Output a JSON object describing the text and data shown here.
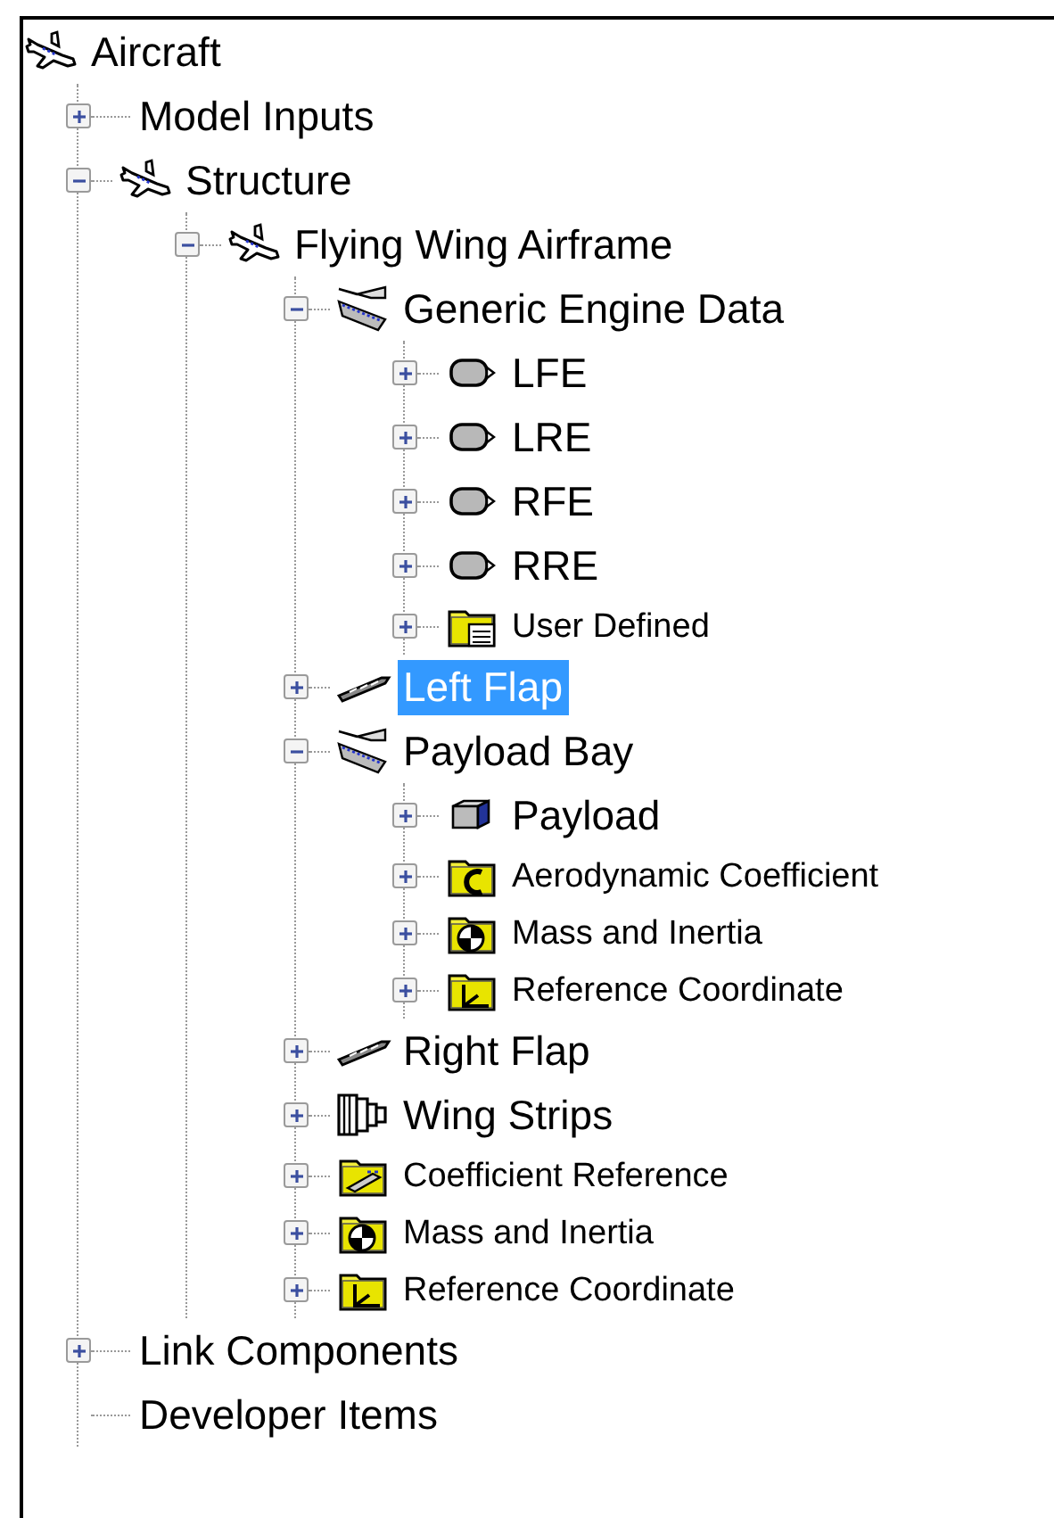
{
  "tree": {
    "label": "Aircraft",
    "kind": "aircraft",
    "selected": false,
    "children": [
      {
        "label": "Model Inputs",
        "kind": "none",
        "expandable": true,
        "expanded": false,
        "selected": false
      },
      {
        "label": "Structure",
        "kind": "aircraft",
        "expandable": true,
        "expanded": true,
        "selected": false,
        "children": [
          {
            "label": "Flying Wing Airframe",
            "kind": "aircraft",
            "expandable": true,
            "expanded": true,
            "selected": false,
            "children": [
              {
                "label": "Generic Engine Data",
                "kind": "section",
                "expandable": true,
                "expanded": true,
                "selected": false,
                "children": [
                  {
                    "label": "LFE",
                    "kind": "engine",
                    "expandable": true,
                    "expanded": false,
                    "selected": false
                  },
                  {
                    "label": "LRE",
                    "kind": "engine",
                    "expandable": true,
                    "expanded": false,
                    "selected": false
                  },
                  {
                    "label": "RFE",
                    "kind": "engine",
                    "expandable": true,
                    "expanded": false,
                    "selected": false
                  },
                  {
                    "label": "RRE",
                    "kind": "engine",
                    "expandable": true,
                    "expanded": false,
                    "selected": false
                  },
                  {
                    "label": "User Defined",
                    "kind": "document-folder",
                    "expandable": true,
                    "expanded": false,
                    "selected": false
                  }
                ]
              },
              {
                "label": "Left Flap",
                "kind": "flap",
                "expandable": true,
                "expanded": false,
                "selected": true
              },
              {
                "label": "Payload Bay",
                "kind": "section",
                "expandable": true,
                "expanded": true,
                "selected": false,
                "children": [
                  {
                    "label": "Payload",
                    "kind": "payload",
                    "expandable": true,
                    "expanded": false,
                    "selected": false
                  },
                  {
                    "label": "Aerodynamic Coefficient",
                    "kind": "coefficient-folder",
                    "expandable": true,
                    "expanded": false,
                    "selected": false
                  },
                  {
                    "label": "Mass and Inertia",
                    "kind": "mass-folder",
                    "expandable": true,
                    "expanded": false,
                    "selected": false
                  },
                  {
                    "label": "Reference Coordinate",
                    "kind": "axes-folder",
                    "expandable": true,
                    "expanded": false,
                    "selected": false
                  }
                ]
              },
              {
                "label": "Right Flap",
                "kind": "flap",
                "expandable": true,
                "expanded": false,
                "selected": false
              },
              {
                "label": "Wing Strips",
                "kind": "strips",
                "expandable": true,
                "expanded": false,
                "selected": false
              },
              {
                "label": "Coefficient Reference",
                "kind": "wing-folder",
                "expandable": true,
                "expanded": false,
                "selected": false
              },
              {
                "label": "Mass and Inertia",
                "kind": "mass-folder",
                "expandable": true,
                "expanded": false,
                "selected": false
              },
              {
                "label": "Reference Coordinate",
                "kind": "axes-folder",
                "expandable": true,
                "expanded": false,
                "selected": false
              }
            ]
          }
        ]
      },
      {
        "label": "Link Components",
        "kind": "none",
        "expandable": true,
        "expanded": false,
        "selected": false
      },
      {
        "label": "Developer Items",
        "kind": "none",
        "expandable": false,
        "selected": false
      }
    ]
  }
}
